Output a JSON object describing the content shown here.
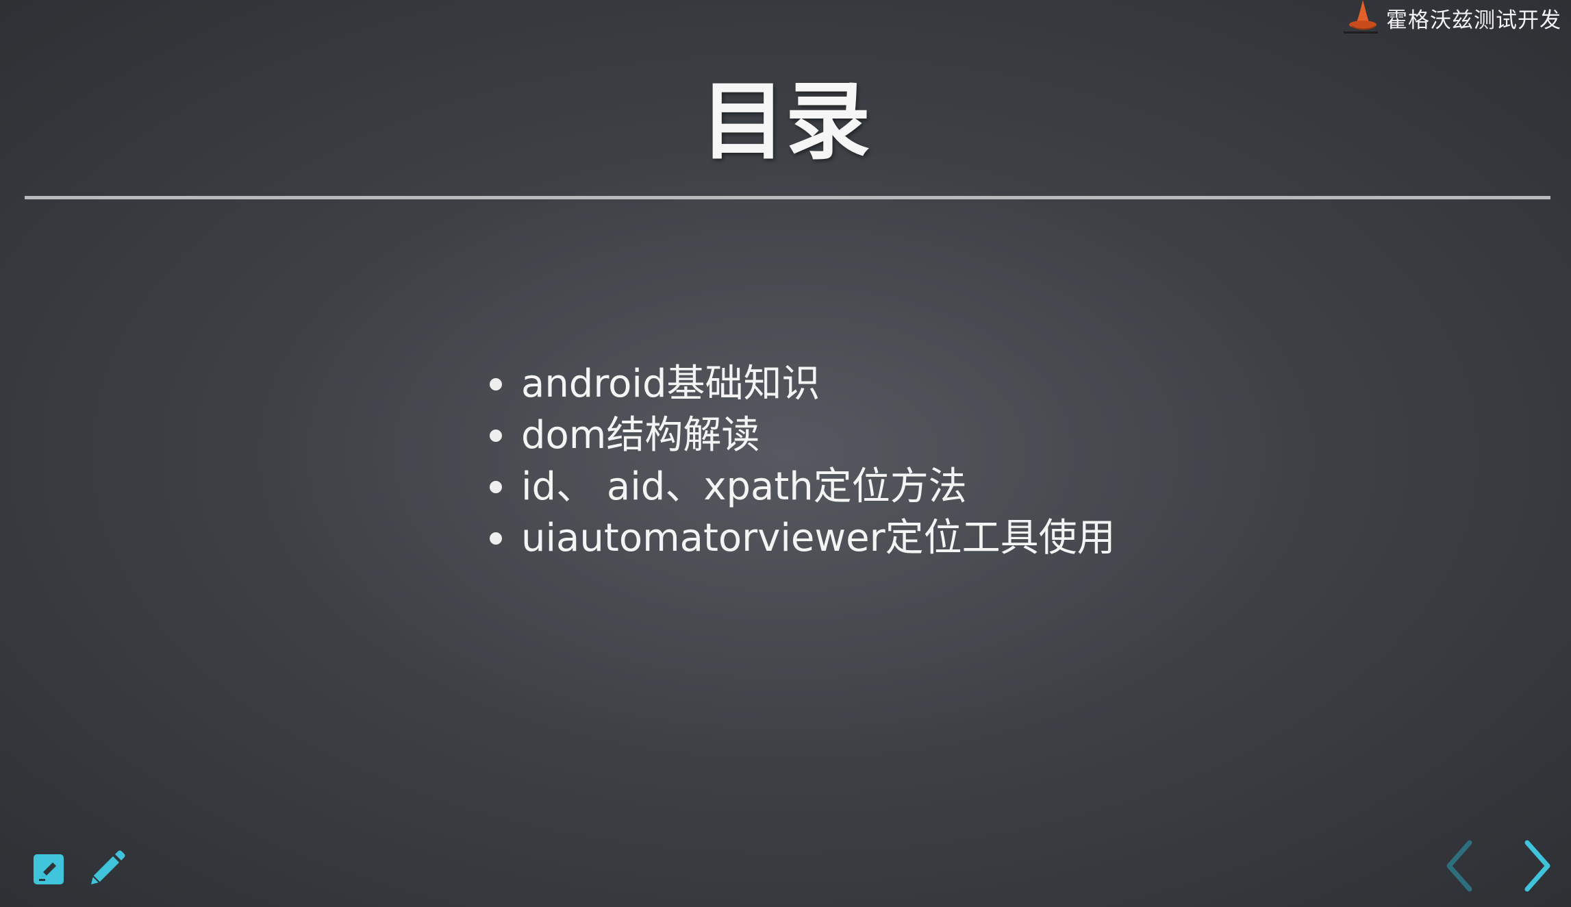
{
  "brand": {
    "name": "霍格沃兹测试开发",
    "logo_icon": "wizard-hat-logo-icon"
  },
  "slide": {
    "title": "目录",
    "items": [
      "android基础知识",
      "dom结构解读",
      "id、 aid、xpath定位方法",
      "uiautomatorviewer定位工具使用"
    ]
  },
  "toolbar": {
    "left_icons": [
      "edit-square-icon",
      "pencil-icon"
    ],
    "right_icons": [
      "chevron-left-icon",
      "chevron-right-icon"
    ]
  },
  "colors": {
    "accent": "#3fc4dc",
    "accent_dim": "#2e6f7e",
    "logo": "#e2602a",
    "rule": "#b9babb"
  }
}
